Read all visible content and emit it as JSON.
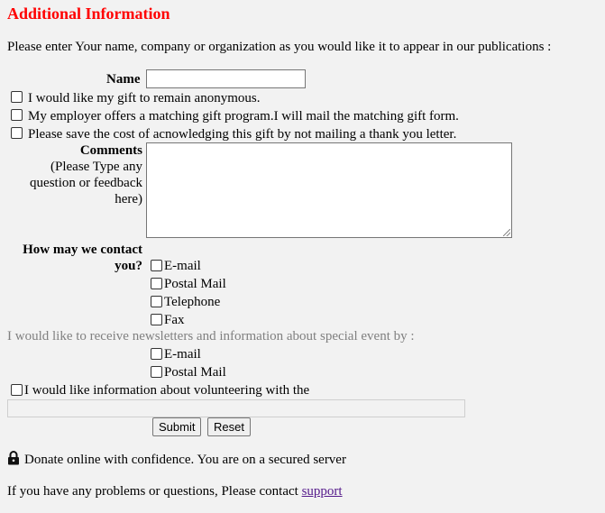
{
  "heading": "Additional Information",
  "intro": "Please enter Your name, company or organization as you would like it to appear in our publications :",
  "name": {
    "label": "Name",
    "value": ""
  },
  "options": [
    {
      "label": "I would like my gift to remain anonymous.",
      "checked": false
    },
    {
      "label": "My employer offers a matching gift program.I will mail the matching gift form.",
      "checked": false
    },
    {
      "label": "Please save the cost of acnowledging this gift by not mailing a thank you letter.",
      "checked": false
    }
  ],
  "comments": {
    "label": "Comments",
    "hint": "(Please Type any question or feedback here)",
    "value": ""
  },
  "contact": {
    "label": "How may we contact you?",
    "options": [
      "E-mail",
      "Postal Mail",
      "Telephone",
      "Fax"
    ]
  },
  "newsletter": {
    "label": "I would like to receive newsletters and information about special event by :",
    "options": [
      "E-mail",
      "Postal Mail"
    ]
  },
  "volunteer": {
    "label": "I would like information about volunteering with the",
    "value": ""
  },
  "buttons": {
    "submit": "Submit",
    "reset": "Reset"
  },
  "secure_text": "Donate online with confidence. You are on a secured server",
  "contact_line": {
    "text": "If you have any problems or questions, Please contact ",
    "link": "support"
  }
}
